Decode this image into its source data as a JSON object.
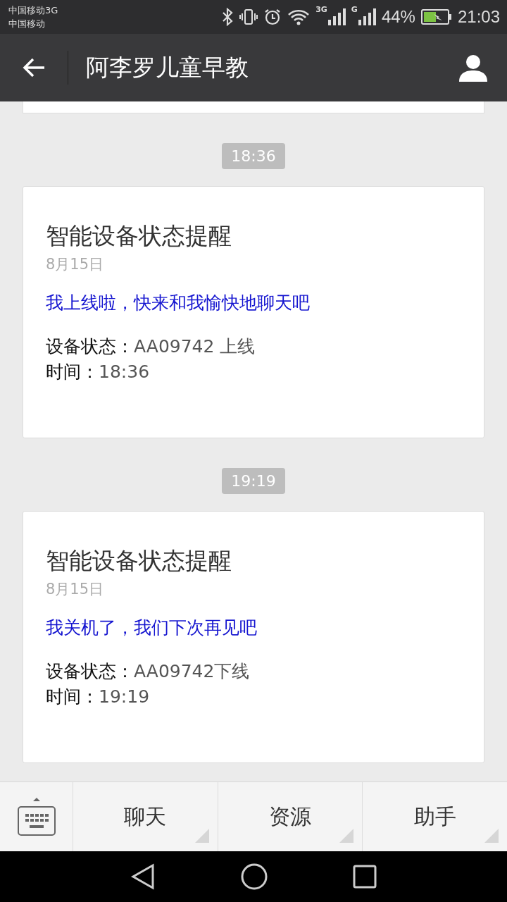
{
  "status_bar": {
    "carriers": [
      "中国移动3G",
      "中国移动"
    ],
    "network_labels": [
      "3G",
      "G"
    ],
    "battery": "44%",
    "time": "21:03"
  },
  "nav": {
    "title": "阿李罗儿童早教"
  },
  "messages": [
    {
      "time": "18:36",
      "title": "智能设备状态提醒",
      "date": "8月15日",
      "text": "我上线啦，快来和我愉快地聊天吧",
      "fields": [
        {
          "label": "设备状态：",
          "value": "AA09742 上线"
        },
        {
          "label": "时间：",
          "value": "18:36"
        }
      ]
    },
    {
      "time": "19:19",
      "title": "智能设备状态提醒",
      "date": "8月15日",
      "text": "我关机了，我们下次再见吧",
      "fields": [
        {
          "label": "设备状态：",
          "value": "AA09742下线"
        },
        {
          "label": "时间：",
          "value": "19:19"
        }
      ]
    }
  ],
  "menu": [
    "聊天",
    "资源",
    "助手"
  ]
}
